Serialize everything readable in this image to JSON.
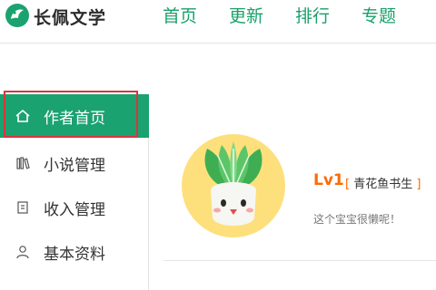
{
  "header": {
    "site_name": "长佩文学",
    "nav": [
      "首页",
      "更新",
      "排行",
      "专题"
    ]
  },
  "sidebar": {
    "items": [
      {
        "label": "作者首页",
        "icon": "home-icon",
        "active": true
      },
      {
        "label": "小说管理",
        "icon": "books-icon",
        "active": false
      },
      {
        "label": "收入管理",
        "icon": "ledger-icon",
        "active": false
      },
      {
        "label": "基本资料",
        "icon": "user-icon",
        "active": false
      }
    ]
  },
  "profile": {
    "level": "Lv1",
    "title_open": "[",
    "title": "青花鱼书生",
    "title_close": "]",
    "signature": "这个宝宝很懒呢！"
  },
  "colors": {
    "accent": "#1aa270",
    "level": "#ff6a00",
    "highlight": "#d9363e"
  }
}
